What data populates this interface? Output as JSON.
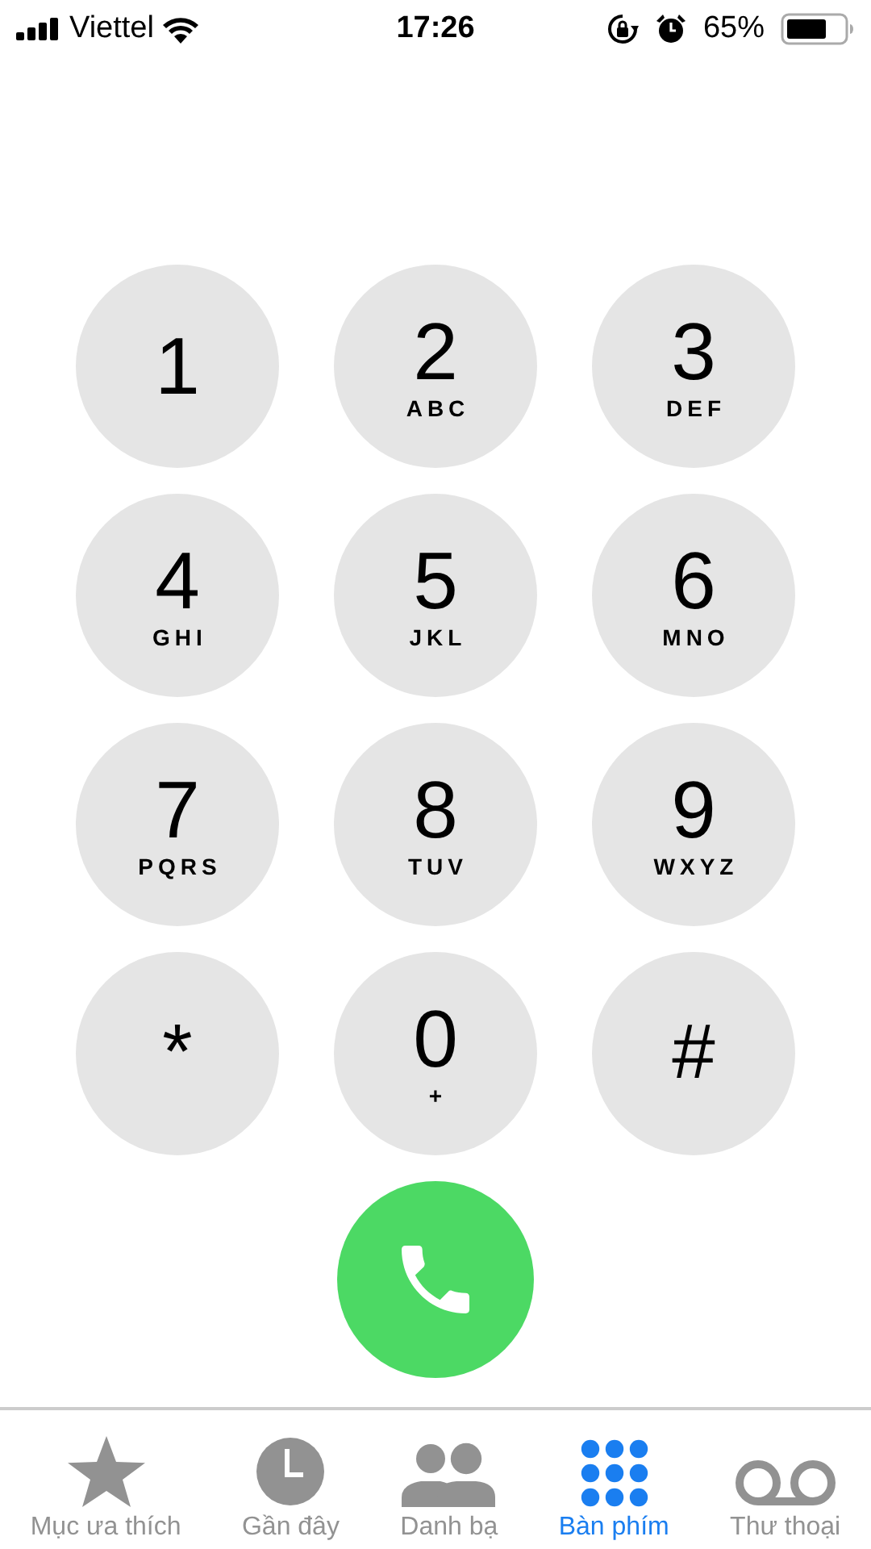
{
  "status_bar": {
    "carrier": "Viettel",
    "time": "17:26",
    "battery_percent": "65%"
  },
  "keys": [
    {
      "digit": "1"
    },
    {
      "digit": "2",
      "letters": "ABC"
    },
    {
      "digit": "3",
      "letters": "DEF"
    },
    {
      "digit": "4",
      "letters": "GHI"
    },
    {
      "digit": "5",
      "letters": "JKL"
    },
    {
      "digit": "6",
      "letters": "MNO"
    },
    {
      "digit": "7",
      "letters": "PQRS"
    },
    {
      "digit": "8",
      "letters": "TUV"
    },
    {
      "digit": "9",
      "letters": "WXYZ"
    },
    {
      "digit": "*"
    },
    {
      "digit": "0",
      "letters": "+"
    },
    {
      "digit": "#"
    }
  ],
  "tabs": [
    {
      "label": "Mục ưa thích",
      "kind": "favorites",
      "selected": false
    },
    {
      "label": "Gần đây",
      "kind": "recents",
      "selected": false
    },
    {
      "label": "Danh bạ",
      "kind": "contacts",
      "selected": false
    },
    {
      "label": "Bàn phím",
      "kind": "keypad",
      "selected": true
    },
    {
      "label": "Thư thoại",
      "kind": "voicemail",
      "selected": false
    }
  ]
}
